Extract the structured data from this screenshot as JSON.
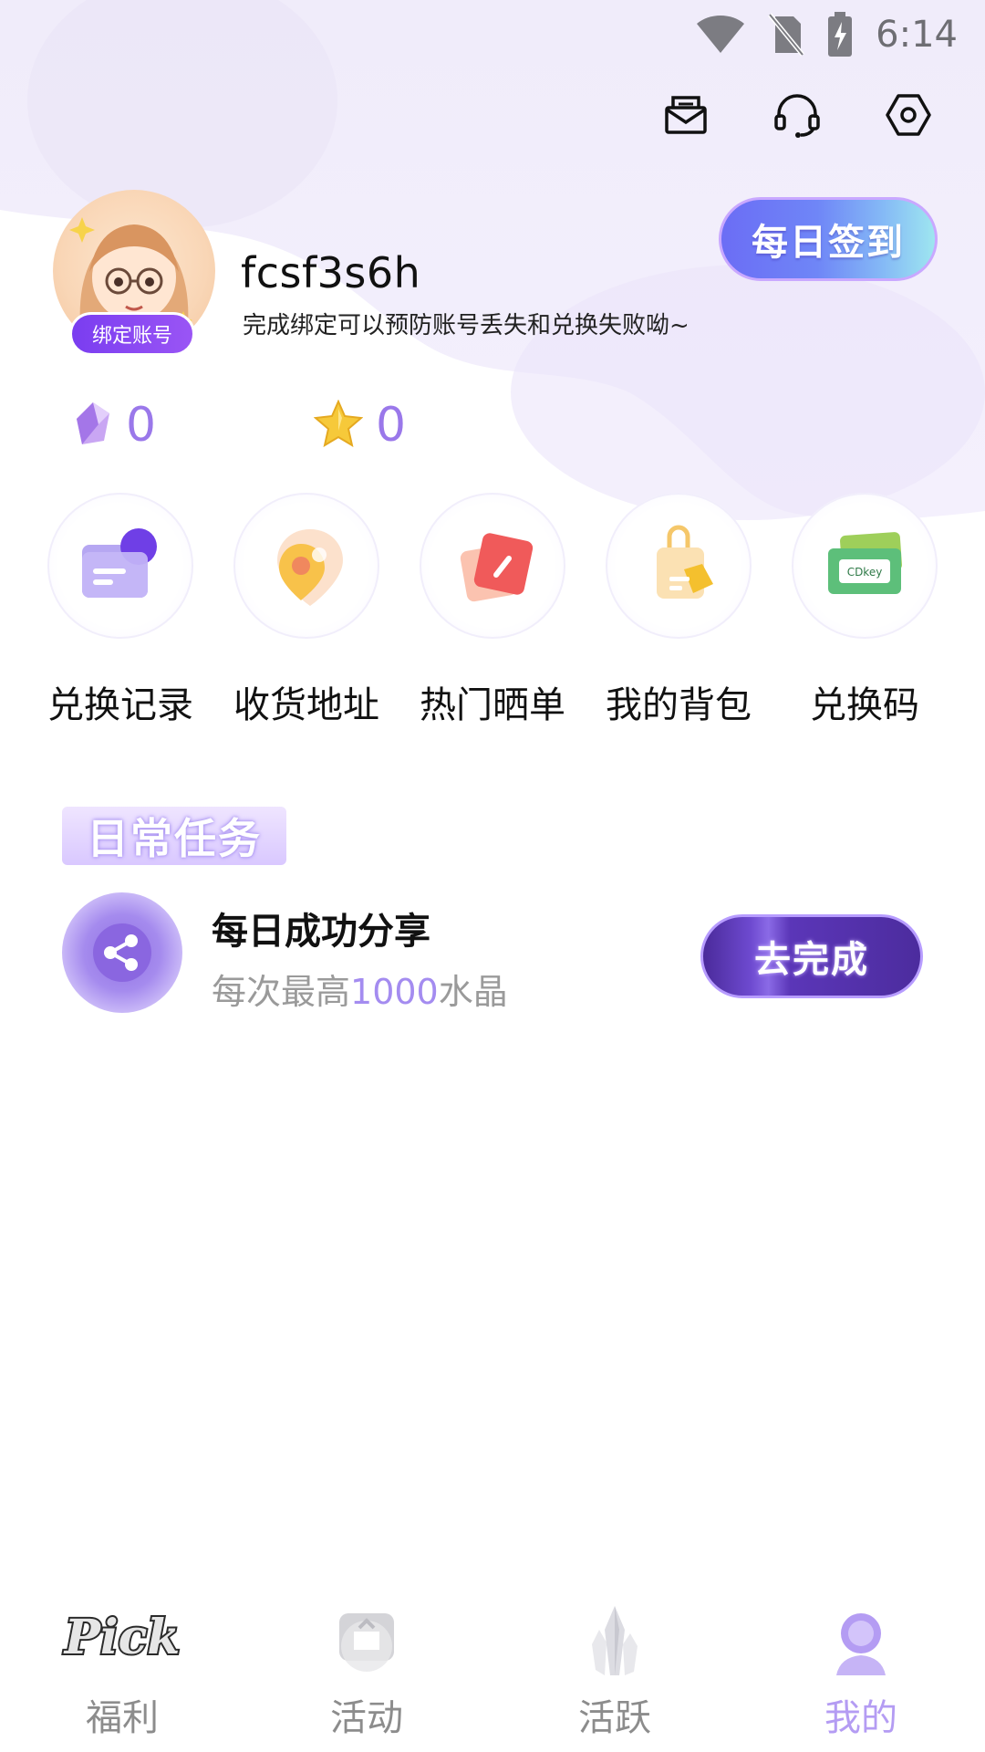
{
  "status_bar": {
    "time": "6:14",
    "icons": [
      "wifi-icon",
      "no-sim-icon",
      "battery-charging-icon"
    ]
  },
  "header_actions": {
    "icons": [
      "mail-icon",
      "headset-icon",
      "settings-icon"
    ]
  },
  "profile": {
    "username": "fcsf3s6h",
    "bind_badge": "绑定账号",
    "bind_tip": "完成绑定可以预防账号丢失和兑换失败呦~",
    "signin_label": "每日签到"
  },
  "currency": {
    "crystal_count": "0",
    "star_count": "0"
  },
  "quick_menu": [
    {
      "label": "兑换记录",
      "icon": "exchange-record-icon"
    },
    {
      "label": "收货地址",
      "icon": "location-pin-icon"
    },
    {
      "label": "热门晒单",
      "icon": "hot-share-icon"
    },
    {
      "label": "我的背包",
      "icon": "backpack-icon"
    },
    {
      "label": "兑换码",
      "icon": "cdkey-icon"
    }
  ],
  "daily_tasks": {
    "title": "日常任务",
    "items": [
      {
        "title": "每日成功分享",
        "desc_prefix": "每次最高",
        "desc_highlight": "1000",
        "desc_suffix": "水晶",
        "button": "去完成",
        "icon": "share-icon"
      }
    ]
  },
  "bottom_nav": {
    "items": [
      {
        "label": "福利",
        "icon": "pick-logo-icon",
        "active": false
      },
      {
        "label": "活动",
        "icon": "activity-icon",
        "active": false
      },
      {
        "label": "活跃",
        "icon": "crystal-icon",
        "active": false
      },
      {
        "label": "我的",
        "icon": "profile-icon",
        "active": true
      }
    ]
  },
  "colors": {
    "accent": "#9a78ea",
    "active_nav": "#b49cf3",
    "inactive_nav": "#8c8c8c",
    "bind_badge": "#7a3df0"
  }
}
